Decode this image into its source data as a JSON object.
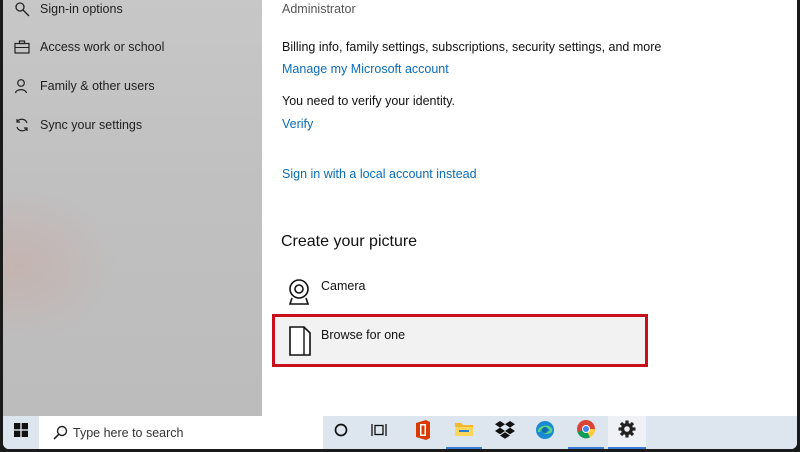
{
  "sidebar": {
    "items": [
      {
        "label": "Sign-in options",
        "icon": "key-icon"
      },
      {
        "label": "Access work or school",
        "icon": "briefcase-icon"
      },
      {
        "label": "Family & other users",
        "icon": "person-icon"
      },
      {
        "label": "Sync your settings",
        "icon": "sync-icon"
      }
    ]
  },
  "main": {
    "account_type": "Administrator",
    "billing_text": "Billing info, family settings, subscriptions, security settings, and more",
    "manage_link": "Manage my Microsoft account",
    "verify_text": "You need to verify your identity.",
    "verify_link": "Verify",
    "local_account_link": "Sign in with a local account instead",
    "picture_heading": "Create your picture",
    "options": [
      {
        "label": "Camera",
        "icon": "camera-icon"
      },
      {
        "label": "Browse for one",
        "icon": "document-icon",
        "highlighted": true
      }
    ]
  },
  "taskbar": {
    "search_placeholder": "Type here to search",
    "icons": [
      "windows-start-icon",
      "search-icon",
      "cortana-icon",
      "task-view-icon",
      "office-icon",
      "file-explorer-icon",
      "dropbox-icon",
      "edge-icon",
      "chrome-icon",
      "settings-icon"
    ]
  },
  "colors": {
    "link": "#0a6cb8",
    "highlight_border": "#c8101a",
    "sidebar_bg": "#c2c2c2",
    "taskbar_bg": "#dde6ef"
  }
}
